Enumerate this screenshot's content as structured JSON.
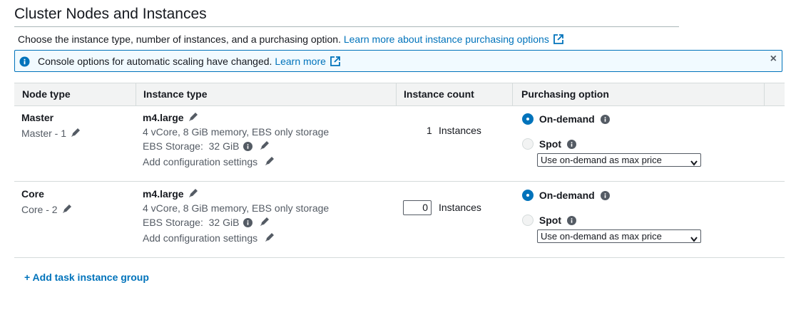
{
  "page_title": "Cluster Nodes and Instances",
  "intro": {
    "text": "Choose the instance type, number of instances, and a purchasing option.",
    "link": "Learn more about instance purchasing options"
  },
  "flash": {
    "message": "Console options for automatic scaling have changed.",
    "link": "Learn more",
    "close": "×"
  },
  "table": {
    "headers": [
      "Node type",
      "Instance type",
      "Instance count",
      "Purchasing option"
    ],
    "rows": [
      {
        "node": "Master",
        "node_sub": "Master - 1",
        "instance_type": "m4.large",
        "specs": "4 vCore, 8 GiB memory, EBS only storage",
        "ebs_label": "EBS Storage:",
        "ebs_value": "32 GiB",
        "config": "Add configuration settings",
        "count": "1",
        "count_unit": "Instances",
        "option_on_demand": "On-demand",
        "option_spot": "Spot",
        "spot_price": "Use on-demand as max price",
        "selected": "On-demand"
      },
      {
        "node": "Core",
        "node_sub": "Core - 2",
        "instance_type": "m4.large",
        "specs": "4 vCore, 8 GiB memory, EBS only storage",
        "ebs_label": "EBS Storage:",
        "ebs_value": "32 GiB",
        "config": "Add configuration settings",
        "count": "0",
        "count_unit": "Instances",
        "option_on_demand": "On-demand",
        "option_spot": "Spot",
        "spot_price": "Use on-demand as max price",
        "selected": "On-demand"
      }
    ]
  },
  "add_task_group": "+ Add task instance group",
  "icons": {
    "edit": "pencil-icon",
    "info": "info-icon",
    "external": "external-link-icon",
    "close": "close-icon",
    "dropdown": "chevron-down-icon"
  },
  "colors": {
    "link": "#0073bb",
    "flash_bg": "#f1faff",
    "header_bg": "#f2f3f3",
    "border": "#d5dbdb"
  }
}
